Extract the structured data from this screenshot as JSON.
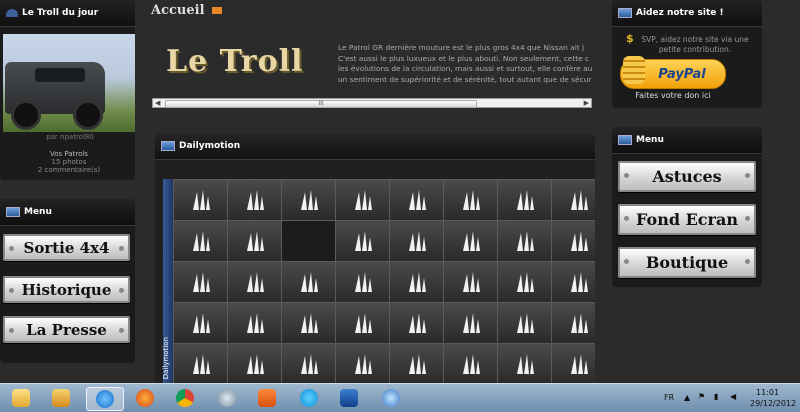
{
  "left": {
    "troll_title": "Le Troll du jour",
    "photo_caption": "par npatrol80",
    "album_title": "Vos Patrols",
    "photos": "15 photos",
    "comments": "2 commentaire(s)",
    "menu_title": "Menu",
    "menu": [
      "Sortie 4x4",
      "Historique",
      "La Presse"
    ]
  },
  "center": {
    "title": "Accueil",
    "logo": "Le Troll",
    "intro": [
      "Le Patrol GR dernière mouture est le plus gros 4x4 que Nissan ait j",
      "C'est aussi le plus luxueux et le plus abouti. Non seulement, cette c",
      "les évolutions de la circulation, mais aussi et surtout, elle confère au",
      "un sentiment de supériorité et de sérénité, tout autant que de sécur"
    ],
    "scroll_grip": "III",
    "dailymotion_title": "Dailymotion",
    "dailymotion_side": "Dailymotion"
  },
  "right": {
    "support_title": "Aidez notre site !",
    "support_text": "SVP, aidez notre site via une petite contribution.",
    "paypal": "PayPal",
    "donate": "Faites votre don ici",
    "menu_title": "Menu",
    "menu": [
      "Astuces",
      "Fond Ecran",
      "Boutique"
    ]
  },
  "taskbar": {
    "lang": "FR",
    "time": "11:01",
    "date": "29/12/2012"
  }
}
